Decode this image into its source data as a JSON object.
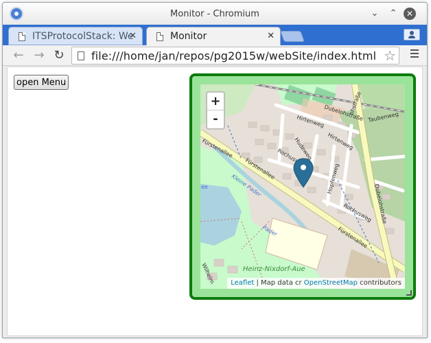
{
  "window": {
    "title": "Monitor - Chromium"
  },
  "titlebar_buttons": {
    "minimize": "⌄",
    "maximize": "⌃",
    "close": "✕"
  },
  "tabs": [
    {
      "label": "ITSProtocolStack: We",
      "close": "✕"
    },
    {
      "label": "Monitor",
      "close": "✕"
    }
  ],
  "toolbar": {
    "back": "←",
    "forward": "→",
    "reload": "↻",
    "url": "file:///home/jan/repos/pg2015w/webSite/index.html",
    "star": "☆"
  },
  "page": {
    "open_menu_label": "open Menu"
  },
  "map": {
    "zoom_in": "+",
    "zoom_out": "-",
    "attribution": {
      "leaflet": "Leaflet",
      "mid": " | Map data cr ",
      "osm": "OpenStreetMap",
      "end": " contributors"
    },
    "street_labels": {
      "fuerstenallee_1": "Fürstenallee",
      "fuerstenallee_2": "Fürstenallee",
      "fuerstenallee_3": "Fürstenallee",
      "rochusweg_1": "Rochusweg",
      "rochusweg_2": "Rochusweg",
      "hirtenweg_1": "Hirtenweg",
      "hirtenweg_2": "Hirtenweg",
      "hudeweg": "Hudeweg",
      "hopfenweg": "Hopfenweg",
      "duebelohstrasse_1": "Dubelohstraße",
      "duebelohstrasse_2": "Dubelohstraße",
      "duebelohstrasse_3": "Dubelohstraße",
      "taubenweg": "Taubenweg",
      "ohstrasse": "ohstraße",
      "kleine_pader": "Kleine Pader",
      "pader": "Pader",
      "heinz_nixdorf_aue": "Heinz-Nixdorf-Aue",
      "wilhelm": "Wilhelm",
      "ee": "ee"
    },
    "colors": {
      "frame_border": "#0c7b0c",
      "frame_fill": "#9ae39a",
      "marker": "#2a6f97",
      "park": "#c8facc",
      "forest": "#add19e",
      "water": "#aad3df",
      "road_primary": "#f7fabf",
      "road_residential": "#ffffff",
      "building": "#d9d0c9",
      "railway": "#8a8a8a",
      "school": "#ffffe5"
    }
  }
}
